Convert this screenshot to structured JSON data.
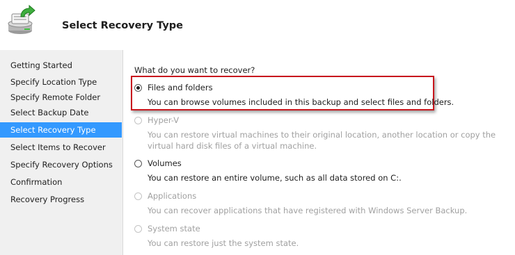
{
  "header": {
    "title": "Select Recovery Type"
  },
  "sidebar": {
    "items": [
      {
        "label": "Getting Started",
        "active": false
      },
      {
        "label": "Specify Location Type",
        "active": false
      },
      {
        "label": "Specify Remote Folder",
        "active": false
      },
      {
        "label": "Select Backup Date",
        "active": false
      },
      {
        "label": "Select Recovery Type",
        "active": true
      },
      {
        "label": "Select Items to Recover",
        "active": false
      },
      {
        "label": "Specify Recovery Options",
        "active": false
      },
      {
        "label": "Confirmation",
        "active": false
      },
      {
        "label": "Recovery Progress",
        "active": false
      }
    ]
  },
  "main": {
    "question": "What do you want to recover?",
    "options": [
      {
        "label": "Files and folders",
        "description": "You can browse volumes included in this backup and select files and folders.",
        "checked": true,
        "enabled": true
      },
      {
        "label": "Hyper-V",
        "description": "You can restore virtual machines to their original location, another location or copy the virtual hard disk files of a virtual machine.",
        "checked": false,
        "enabled": false
      },
      {
        "label": "Volumes",
        "description": "You can restore an entire volume, such as all data stored on C:.",
        "checked": false,
        "enabled": true
      },
      {
        "label": "Applications",
        "description": "You can recover applications that have registered with Windows Server Backup.",
        "checked": false,
        "enabled": false
      },
      {
        "label": "System state",
        "description": "You can restore just the system state.",
        "checked": false,
        "enabled": false
      }
    ]
  },
  "colors": {
    "accent": "#3399ff",
    "highlight_border": "#c8161d",
    "disabled_text": "#a0a0a0"
  },
  "icons": {
    "header": "backup-recovery-icon"
  }
}
